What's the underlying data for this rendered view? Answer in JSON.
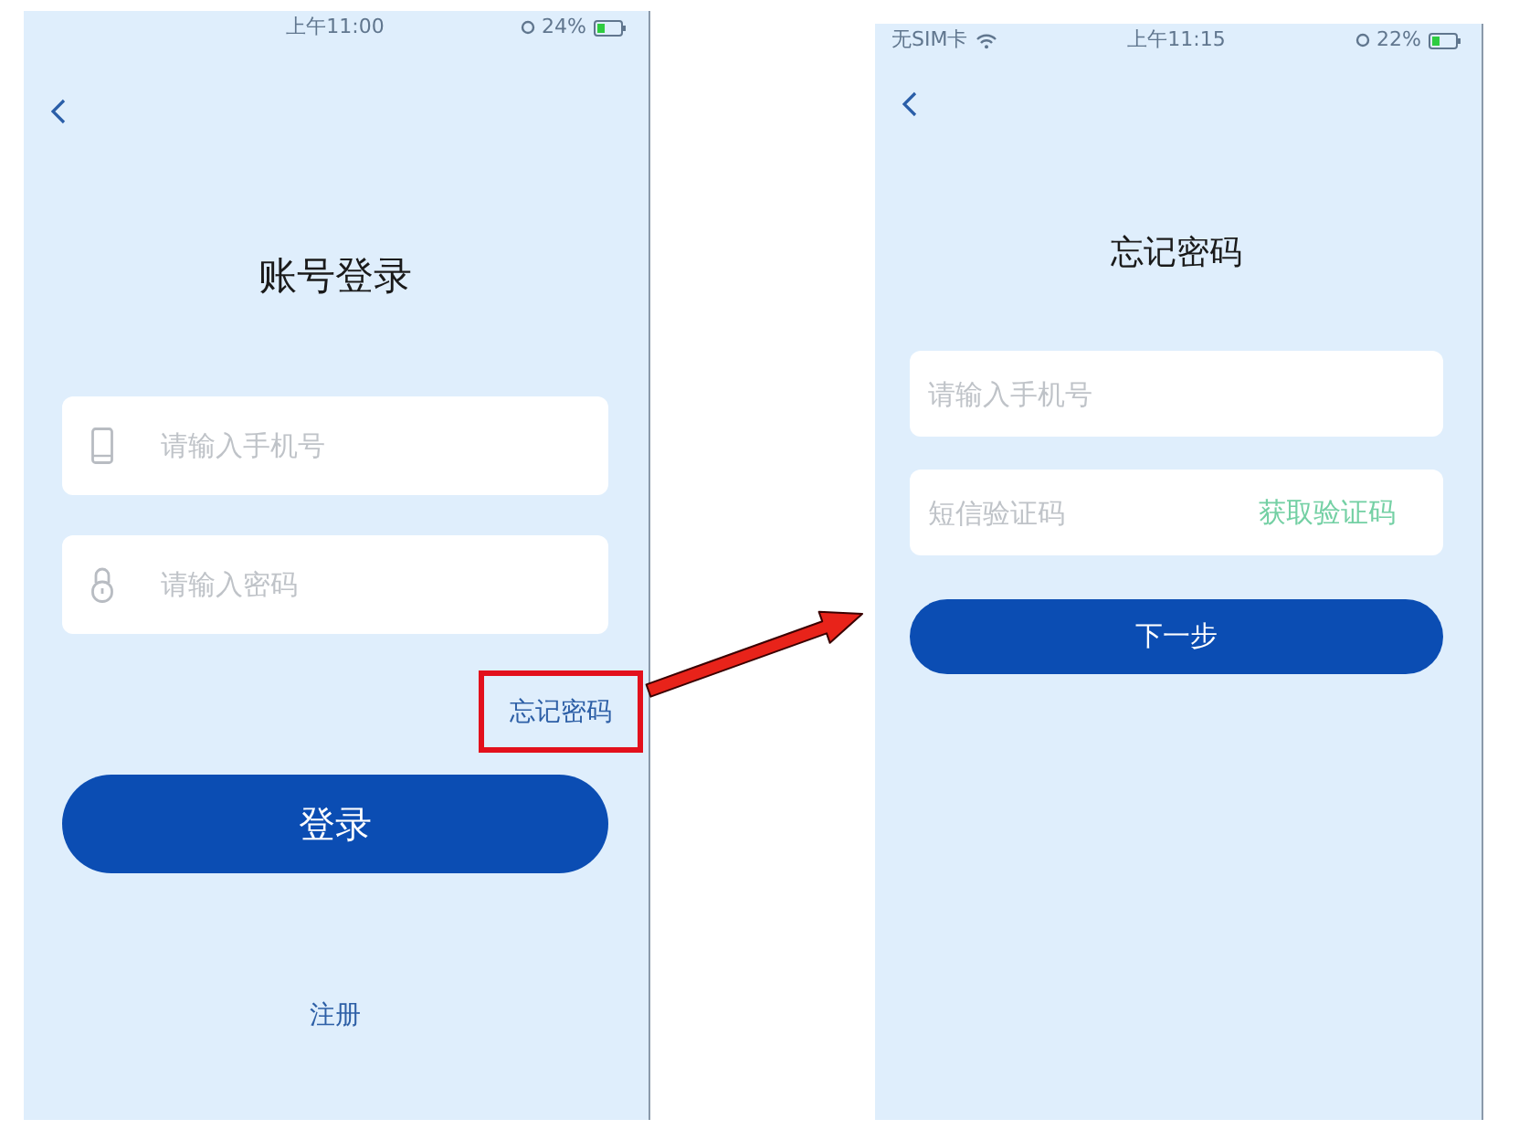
{
  "login_screen": {
    "status_bar": {
      "time": "上午11:00",
      "battery": "24%"
    },
    "title": "账号登录",
    "fields": [
      {
        "kind": "phone",
        "placeholder": "请输入手机号"
      },
      {
        "kind": "password",
        "placeholder": "请输入密码"
      }
    ],
    "forgot_link": "忘记密码",
    "primary_button": "登录",
    "register_link": "注册"
  },
  "forgot_screen": {
    "status_bar": {
      "carrier": "无SIM卡",
      "time": "上午11:15",
      "battery": "22%"
    },
    "title": "忘记密码",
    "fields": [
      {
        "placeholder": "请输入手机号"
      },
      {
        "placeholder": "短信验证码",
        "action": "获取验证码"
      }
    ],
    "primary_button": "下一步"
  }
}
